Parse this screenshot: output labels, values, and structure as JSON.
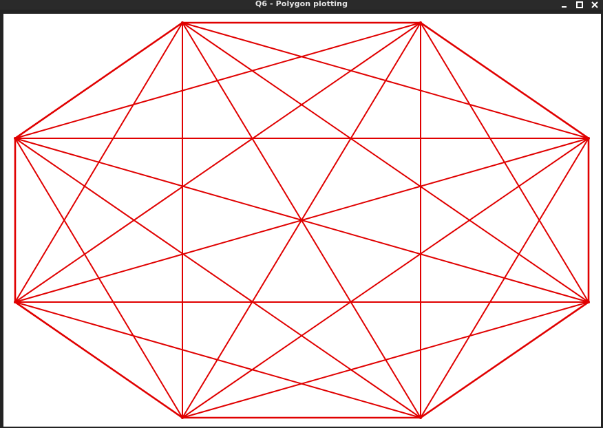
{
  "window": {
    "title": "Q6 - Polygon plotting",
    "controls": {
      "minimize_icon": "minimize-icon",
      "maximize_icon": "maximize-icon",
      "close_icon": "close-icon"
    }
  },
  "plot": {
    "line_color": "#e00000",
    "background_color": "#ffffff",
    "shape": "octagon-complete-graph",
    "vertex_count": 8
  }
}
